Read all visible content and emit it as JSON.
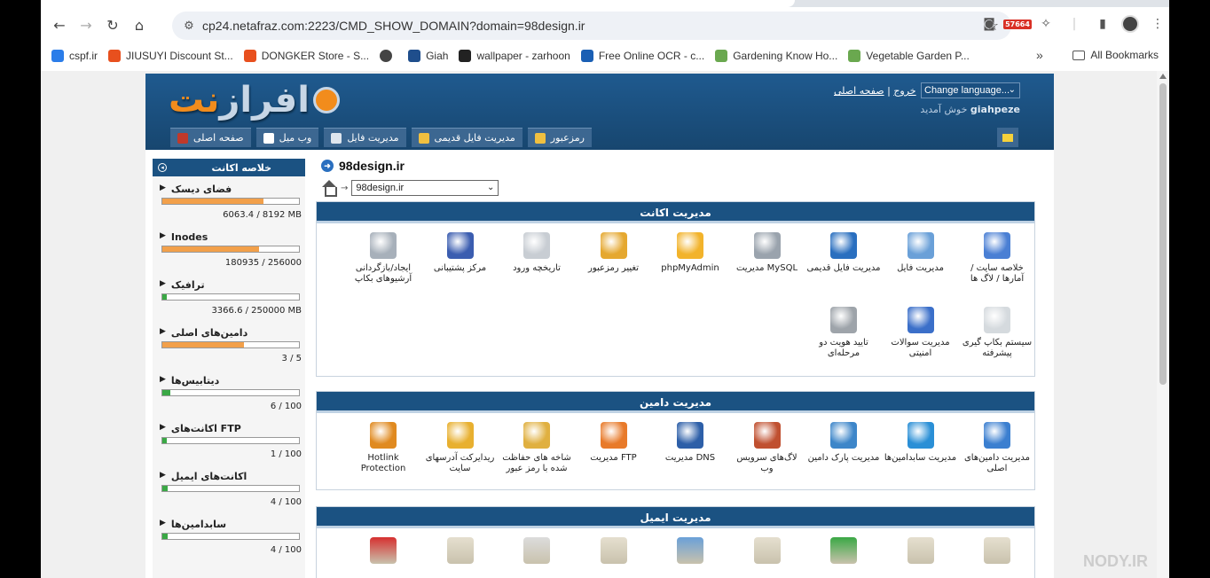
{
  "browser": {
    "url": "cp24.netafraz.com:2223/CMD_SHOW_DOMAIN?domain=98design.ir",
    "badge": "57664",
    "bookmarks": [
      {
        "label": "cspf.ir",
        "color": "#2b7de9"
      },
      {
        "label": "JIUSUYI Discount St...",
        "color": "#e8501e"
      },
      {
        "label": "DONGKER Store - S...",
        "color": "#e8501e"
      },
      {
        "label": "",
        "color": "#444444"
      },
      {
        "label": "Giah",
        "color": "#1f4e8c"
      },
      {
        "label": "wallpaper - zarhoon",
        "color": "#222222"
      },
      {
        "label": "Free Online OCR - c...",
        "color": "#1a5fb4"
      },
      {
        "label": "Gardening Know Ho...",
        "color": "#6aa84f"
      },
      {
        "label": "Vegetable Garden P...",
        "color": "#6aa84f"
      }
    ],
    "more": "»",
    "all_bookmarks": "All Bookmarks"
  },
  "header": {
    "logo_text": "نت",
    "logo_text2": "افراز",
    "link_home": "صفحه اصلی",
    "link_sep": "|",
    "link_logout": "خروج",
    "language": "Change language...",
    "welcome_text": "خوش آمدید",
    "username": "giahpeze",
    "tabs": [
      {
        "label": "صفحه اصلی",
        "color": "#c0392b"
      },
      {
        "label": "وب میل",
        "color": "#ffffff"
      },
      {
        "label": "مدیریت فایل",
        "color": "#dfe6ee"
      },
      {
        "label": "مدیریت فایل قدیمی",
        "color": "#f0c040"
      },
      {
        "label": "رمزعبور",
        "color": "#f0c040"
      }
    ]
  },
  "sidebar": {
    "title": "خلاصه اکانت",
    "items": [
      {
        "title": "فضای دیسک",
        "value": "6063.4 / 8192 MB",
        "percent": 74,
        "color": "#f2a04a"
      },
      {
        "title": "Inodes",
        "value": "180935 / 256000",
        "percent": 71,
        "color": "#f2a04a"
      },
      {
        "title": "ترافیک",
        "value": "3366.6 / 250000 MB",
        "percent": 1.5,
        "color": "#3aa845"
      },
      {
        "title": "دامین‌های اصلی",
        "value": "3 / 5",
        "percent": 60,
        "color": "#f2a04a"
      },
      {
        "title": "دیتابیس‌ها",
        "value": "6 / 100",
        "percent": 6,
        "color": "#3aa845"
      },
      {
        "title": "اکانت‌های FTP",
        "value": "1 / 100",
        "percent": 1,
        "color": "#3aa845"
      },
      {
        "title": "اکانت‌های ایمیل",
        "value": "4 / 100",
        "percent": 4,
        "color": "#3aa845"
      },
      {
        "title": "سابدامین‌ها",
        "value": "4 / 100",
        "percent": 4,
        "color": "#3aa845"
      }
    ]
  },
  "main": {
    "domain": "98design.ir",
    "crumb_arrow": "→",
    "selected_domain": "98design.ir",
    "account_section": {
      "title": "مدیریت اکانت",
      "row1": [
        {
          "label": "خلاصه سایت / آمارها / لاگ ها",
          "icon": "stats-icon",
          "color": "#4a7fd4"
        },
        {
          "label": "مدیریت فایل",
          "icon": "file-manager-icon",
          "color": "#6aa0d8"
        },
        {
          "label": "مدیریت فایل قدیمی",
          "icon": "old-file-manager-icon",
          "color": "#2a6fbf"
        },
        {
          "label": "مدیریت MySQL",
          "icon": "database-icon",
          "color": "#9aa3ad"
        },
        {
          "label": "phpMyAdmin",
          "icon": "phpmyadmin-icon",
          "color": "#f2b32b"
        },
        {
          "label": "تغییر رمزعبور",
          "icon": "lock-icon",
          "color": "#e5a830"
        },
        {
          "label": "تاریخچه ورود",
          "icon": "login-history-icon",
          "color": "#c8cdd3"
        },
        {
          "label": "مرکز پشتیبانی",
          "icon": "support-icon",
          "color": "#3b5db0"
        },
        {
          "label": "ایجاد/بازگردانی آرشیوهای بکاپ",
          "icon": "backup-icon",
          "color": "#a7b0ba"
        }
      ],
      "row2": [
        {
          "label": "سیستم بکاپ گیری پیشرفته",
          "icon": "advanced-backup-icon",
          "color": "#d5dade"
        },
        {
          "label": "مدیریت سوالات امنیتی",
          "icon": "security-question-icon",
          "color": "#3b6fc9"
        },
        {
          "label": "تایید هویت دو مرحله‌ای",
          "icon": "two-factor-icon",
          "color": "#9ea4aa"
        }
      ]
    },
    "domain_section": {
      "title": "مدیریت دامین",
      "items": [
        {
          "label": "مدیریت دامین‌های اصلی",
          "icon": "domains-icon",
          "color": "#3b7fd0"
        },
        {
          "label": "مدیریت سابدامین‌ها",
          "icon": "subdomains-icon",
          "color": "#2a8fd6"
        },
        {
          "label": "مدیریت پارک دامین",
          "icon": "parked-domain-icon",
          "color": "#3d86c9"
        },
        {
          "label": "لاگ‌های سرویس وب",
          "icon": "web-log-icon",
          "color": "#c05030"
        },
        {
          "label": "مدیریت DNS",
          "icon": "dns-icon",
          "color": "#2d5fa8"
        },
        {
          "label": "مدیریت FTP",
          "icon": "ftp-icon",
          "color": "#e87a2a"
        },
        {
          "label": "شاخه های حفاظت شده با رمز عبور",
          "icon": "protected-dir-icon",
          "color": "#e0b040"
        },
        {
          "label": "ریدایرکت آدرسهای سایت",
          "icon": "redirect-icon",
          "color": "#e8b030"
        },
        {
          "label": "Hotlink Protection",
          "icon": "hotlink-icon",
          "color": "#e08a20"
        }
      ]
    },
    "email_section": {
      "title": "مدیریت ایمیل",
      "icons": [
        "#e5dfcf",
        "#e5dfcf",
        "#3aa845",
        "#e5dfcf",
        "#6aa0d8",
        "#e5dfcf",
        "#dcdcdc",
        "#e5dfcf",
        "#d63030"
      ]
    }
  },
  "watermark": "NODY.IR"
}
